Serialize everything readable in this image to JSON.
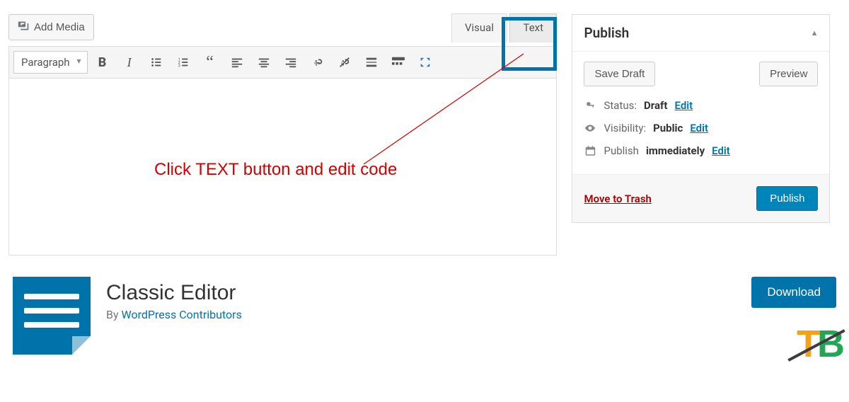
{
  "editor": {
    "add_media": "Add Media",
    "tabs": {
      "visual": "Visual",
      "text": "Text"
    },
    "format_select": "Paragraph",
    "annotation": "Click TEXT button and edit code"
  },
  "publish": {
    "title": "Publish",
    "save_draft": "Save Draft",
    "preview": "Preview",
    "status_label": "Status:",
    "status_value": "Draft",
    "visibility_label": "Visibility:",
    "visibility_value": "Public",
    "schedule_label": "Publish",
    "schedule_value": "immediately",
    "edit": "Edit",
    "trash": "Move to Trash",
    "publish_btn": "Publish"
  },
  "plugin": {
    "name": "Classic Editor",
    "by_prefix": "By ",
    "author": "WordPress Contributors",
    "download": "Download"
  }
}
